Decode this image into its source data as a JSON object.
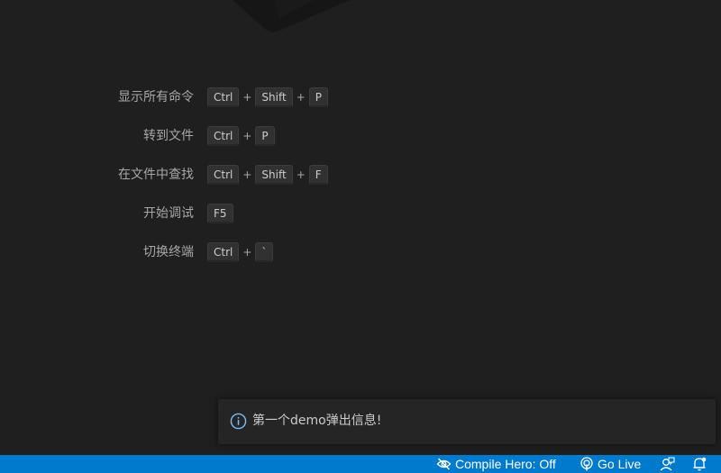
{
  "shortcuts": [
    {
      "label": "显示所有命令",
      "keys": [
        "Ctrl",
        "Shift",
        "P"
      ]
    },
    {
      "label": "转到文件",
      "keys": [
        "Ctrl",
        "P"
      ]
    },
    {
      "label": "在文件中查找",
      "keys": [
        "Ctrl",
        "Shift",
        "F"
      ]
    },
    {
      "label": "开始调试",
      "keys": [
        "F5"
      ]
    },
    {
      "label": "切换终端",
      "keys": [
        "Ctrl",
        "`"
      ]
    }
  ],
  "key_separator": "+",
  "notification": {
    "icon": "info-icon",
    "message": "第一个demo弹出信息!"
  },
  "status_bar": {
    "compile_hero": {
      "icon": "eye-off-icon",
      "label": "Compile Hero: Off"
    },
    "go_live": {
      "icon": "broadcast-icon",
      "label": "Go Live"
    },
    "feedback": {
      "icon": "feedback-icon"
    },
    "notifications": {
      "icon": "bell-icon"
    }
  },
  "colors": {
    "editor_background": "#1f1f1f",
    "status_bar_background": "#007acc",
    "notification_background": "#252526",
    "info_icon": "#75beff"
  }
}
